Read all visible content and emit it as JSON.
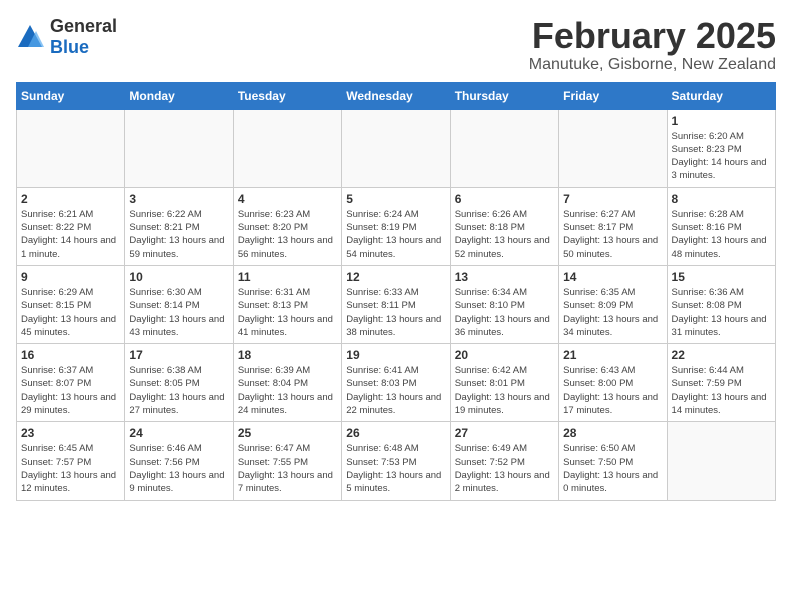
{
  "logo": {
    "general": "General",
    "blue": "Blue"
  },
  "title": "February 2025",
  "location": "Manutuke, Gisborne, New Zealand",
  "days_of_week": [
    "Sunday",
    "Monday",
    "Tuesday",
    "Wednesday",
    "Thursday",
    "Friday",
    "Saturday"
  ],
  "weeks": [
    [
      {
        "day": "",
        "info": ""
      },
      {
        "day": "",
        "info": ""
      },
      {
        "day": "",
        "info": ""
      },
      {
        "day": "",
        "info": ""
      },
      {
        "day": "",
        "info": ""
      },
      {
        "day": "",
        "info": ""
      },
      {
        "day": "1",
        "info": "Sunrise: 6:20 AM\nSunset: 8:23 PM\nDaylight: 14 hours and 3 minutes."
      }
    ],
    [
      {
        "day": "2",
        "info": "Sunrise: 6:21 AM\nSunset: 8:22 PM\nDaylight: 14 hours and 1 minute."
      },
      {
        "day": "3",
        "info": "Sunrise: 6:22 AM\nSunset: 8:21 PM\nDaylight: 13 hours and 59 minutes."
      },
      {
        "day": "4",
        "info": "Sunrise: 6:23 AM\nSunset: 8:20 PM\nDaylight: 13 hours and 56 minutes."
      },
      {
        "day": "5",
        "info": "Sunrise: 6:24 AM\nSunset: 8:19 PM\nDaylight: 13 hours and 54 minutes."
      },
      {
        "day": "6",
        "info": "Sunrise: 6:26 AM\nSunset: 8:18 PM\nDaylight: 13 hours and 52 minutes."
      },
      {
        "day": "7",
        "info": "Sunrise: 6:27 AM\nSunset: 8:17 PM\nDaylight: 13 hours and 50 minutes."
      },
      {
        "day": "8",
        "info": "Sunrise: 6:28 AM\nSunset: 8:16 PM\nDaylight: 13 hours and 48 minutes."
      }
    ],
    [
      {
        "day": "9",
        "info": "Sunrise: 6:29 AM\nSunset: 8:15 PM\nDaylight: 13 hours and 45 minutes."
      },
      {
        "day": "10",
        "info": "Sunrise: 6:30 AM\nSunset: 8:14 PM\nDaylight: 13 hours and 43 minutes."
      },
      {
        "day": "11",
        "info": "Sunrise: 6:31 AM\nSunset: 8:13 PM\nDaylight: 13 hours and 41 minutes."
      },
      {
        "day": "12",
        "info": "Sunrise: 6:33 AM\nSunset: 8:11 PM\nDaylight: 13 hours and 38 minutes."
      },
      {
        "day": "13",
        "info": "Sunrise: 6:34 AM\nSunset: 8:10 PM\nDaylight: 13 hours and 36 minutes."
      },
      {
        "day": "14",
        "info": "Sunrise: 6:35 AM\nSunset: 8:09 PM\nDaylight: 13 hours and 34 minutes."
      },
      {
        "day": "15",
        "info": "Sunrise: 6:36 AM\nSunset: 8:08 PM\nDaylight: 13 hours and 31 minutes."
      }
    ],
    [
      {
        "day": "16",
        "info": "Sunrise: 6:37 AM\nSunset: 8:07 PM\nDaylight: 13 hours and 29 minutes."
      },
      {
        "day": "17",
        "info": "Sunrise: 6:38 AM\nSunset: 8:05 PM\nDaylight: 13 hours and 27 minutes."
      },
      {
        "day": "18",
        "info": "Sunrise: 6:39 AM\nSunset: 8:04 PM\nDaylight: 13 hours and 24 minutes."
      },
      {
        "day": "19",
        "info": "Sunrise: 6:41 AM\nSunset: 8:03 PM\nDaylight: 13 hours and 22 minutes."
      },
      {
        "day": "20",
        "info": "Sunrise: 6:42 AM\nSunset: 8:01 PM\nDaylight: 13 hours and 19 minutes."
      },
      {
        "day": "21",
        "info": "Sunrise: 6:43 AM\nSunset: 8:00 PM\nDaylight: 13 hours and 17 minutes."
      },
      {
        "day": "22",
        "info": "Sunrise: 6:44 AM\nSunset: 7:59 PM\nDaylight: 13 hours and 14 minutes."
      }
    ],
    [
      {
        "day": "23",
        "info": "Sunrise: 6:45 AM\nSunset: 7:57 PM\nDaylight: 13 hours and 12 minutes."
      },
      {
        "day": "24",
        "info": "Sunrise: 6:46 AM\nSunset: 7:56 PM\nDaylight: 13 hours and 9 minutes."
      },
      {
        "day": "25",
        "info": "Sunrise: 6:47 AM\nSunset: 7:55 PM\nDaylight: 13 hours and 7 minutes."
      },
      {
        "day": "26",
        "info": "Sunrise: 6:48 AM\nSunset: 7:53 PM\nDaylight: 13 hours and 5 minutes."
      },
      {
        "day": "27",
        "info": "Sunrise: 6:49 AM\nSunset: 7:52 PM\nDaylight: 13 hours and 2 minutes."
      },
      {
        "day": "28",
        "info": "Sunrise: 6:50 AM\nSunset: 7:50 PM\nDaylight: 13 hours and 0 minutes."
      },
      {
        "day": "",
        "info": ""
      }
    ]
  ]
}
